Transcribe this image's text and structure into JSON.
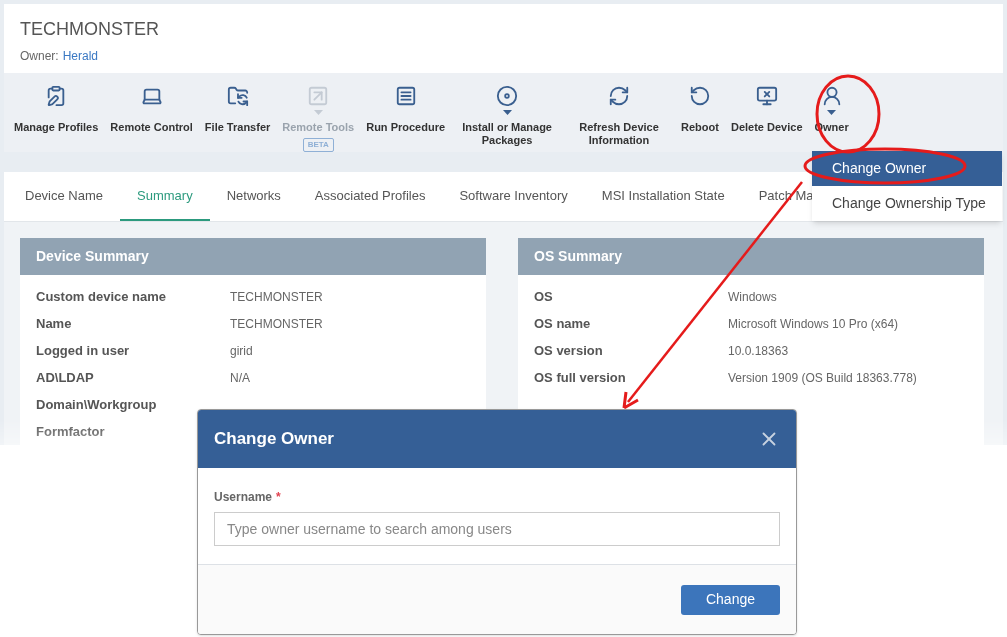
{
  "header": {
    "title": "TECHMONSTER",
    "owner_label": "Owner:",
    "owner_name": "Herald"
  },
  "toolbar": [
    {
      "label": "Manage Profiles",
      "disabled": false,
      "dropdown": false
    },
    {
      "label": "Remote Control",
      "disabled": false,
      "dropdown": false
    },
    {
      "label": "File Transfer",
      "disabled": false,
      "dropdown": false
    },
    {
      "label": "Remote Tools",
      "disabled": true,
      "dropdown": true,
      "badge": "BETA"
    },
    {
      "label": "Run Procedure",
      "disabled": false,
      "dropdown": false
    },
    {
      "label": "Install or Manage Packages",
      "disabled": false,
      "dropdown": true
    },
    {
      "label": "Refresh Device Information",
      "disabled": false,
      "dropdown": false
    },
    {
      "label": "Reboot",
      "disabled": false,
      "dropdown": false
    },
    {
      "label": "Delete Device",
      "disabled": false,
      "dropdown": false
    },
    {
      "label": "Owner",
      "disabled": false,
      "dropdown": true
    }
  ],
  "owner_menu": [
    {
      "label": "Change Owner",
      "selected": true
    },
    {
      "label": "Change Ownership Type",
      "selected": false
    }
  ],
  "tabs": [
    {
      "label": "Device Name",
      "selected": false
    },
    {
      "label": "Summary",
      "selected": true
    },
    {
      "label": "Networks",
      "selected": false
    },
    {
      "label": "Associated Profiles",
      "selected": false
    },
    {
      "label": "Software Inventory",
      "selected": false
    },
    {
      "label": "MSI Installation State",
      "selected": false
    },
    {
      "label": "Patch Ma",
      "selected": false
    }
  ],
  "panels": [
    {
      "title": "Device Summary",
      "rows": [
        {
          "label": "Custom device name",
          "value": "TECHMONSTER"
        },
        {
          "label": "Name",
          "value": "TECHMONSTER"
        },
        {
          "label": "Logged in user",
          "value": "girid"
        },
        {
          "label": "AD\\LDAP",
          "value": "N/A"
        },
        {
          "label": "Domain\\Workgroup"
        },
        {
          "label": "Formfactor"
        }
      ]
    },
    {
      "title": "OS Summary",
      "rows": [
        {
          "label": "OS",
          "value": "Windows"
        },
        {
          "label": "OS name",
          "value": "Microsoft Windows 10 Pro (x64)"
        },
        {
          "label": "OS version",
          "value": "10.0.18363"
        },
        {
          "label": "OS full version",
          "value": "Version 1909 (OS Build 18363.778)"
        }
      ]
    }
  ],
  "dialog": {
    "title": "Change Owner",
    "field_label": "Username",
    "required_mark": "*",
    "placeholder": "Type owner username to search among users",
    "button": "Change"
  }
}
